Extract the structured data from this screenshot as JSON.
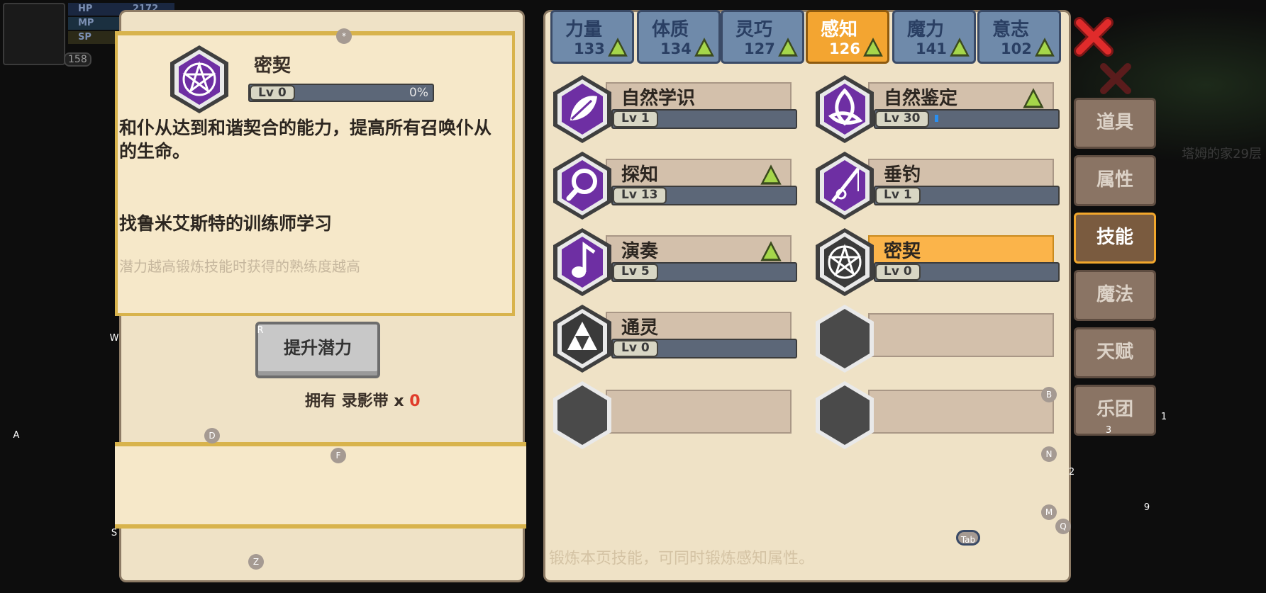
{
  "hud": {
    "hp_label": "HP",
    "hp_value": "2172",
    "mp_label": "MP",
    "sp_label": "SP",
    "level": "158"
  },
  "background": {
    "location_text": "塔姆的家29层"
  },
  "detail": {
    "name": "密契",
    "level": "Lv 0",
    "progress_percent": "0%",
    "description": "和仆从达到和谐契合的能力，提高所有召唤仆从的生命。",
    "trainer": "找鲁米艾斯特的训练师学习",
    "hint": "潜力越高锻炼技能时获得的熟练度越高",
    "potential_button": "提升潜力",
    "own_label": "拥有 录影带 x",
    "own_count": "0"
  },
  "attribute_tabs": [
    {
      "name": "力量",
      "value": "133",
      "up": true
    },
    {
      "name": "体质",
      "value": "134",
      "up": true
    },
    {
      "name": "灵巧",
      "value": "127",
      "up": true
    },
    {
      "name": "感知",
      "value": "126",
      "up": true,
      "active": true
    },
    {
      "name": "魔力",
      "value": "141",
      "up": true
    },
    {
      "name": "意志",
      "value": "102",
      "up": true
    }
  ],
  "skills": [
    {
      "name": "自然学识",
      "level": "Lv 1",
      "progress": 0.0,
      "up": false,
      "icon": "leaf-icon"
    },
    {
      "name": "自然鉴定",
      "level": "Lv 30",
      "progress": 0.03,
      "up": true,
      "icon": "triquetra-icon"
    },
    {
      "name": "探知",
      "level": "Lv 13",
      "progress": 0.0,
      "up": true,
      "icon": "magnifier-icon"
    },
    {
      "name": "垂钓",
      "level": "Lv 1",
      "progress": 0.0,
      "up": false,
      "icon": "fishing-rod-icon"
    },
    {
      "name": "演奏",
      "level": "Lv 5",
      "progress": 0.0,
      "up": true,
      "icon": "music-note-icon"
    },
    {
      "name": "密契",
      "level": "Lv 0",
      "progress": 0.0,
      "up": false,
      "icon": "pentagram-icon",
      "selected": true
    },
    {
      "name": "通灵",
      "level": "Lv 0",
      "progress": 0.0,
      "up": false,
      "icon": "triforce-icon"
    }
  ],
  "side_tabs": [
    "道具",
    "属性",
    "技能",
    "魔法",
    "天赋",
    "乐团"
  ],
  "side_tab_active": "技能",
  "footer": "锻炼本页技能，可同时锻炼感知属性。",
  "key_hints": {
    "star": "*",
    "w": "W",
    "r": "R",
    "a": "A",
    "d": "D",
    "f": "F",
    "s": "S",
    "z": "Z",
    "b": "B",
    "n": "N",
    "m": "M",
    "q": "Q",
    "tab": "Tab",
    "one": "1",
    "two": "2",
    "three": "3",
    "nine": "9"
  },
  "colors": {
    "active_tab": "#f3a531",
    "selected_skill": "#fbb44a",
    "arrow": "#8cc63f",
    "close": "#e02b2b"
  }
}
